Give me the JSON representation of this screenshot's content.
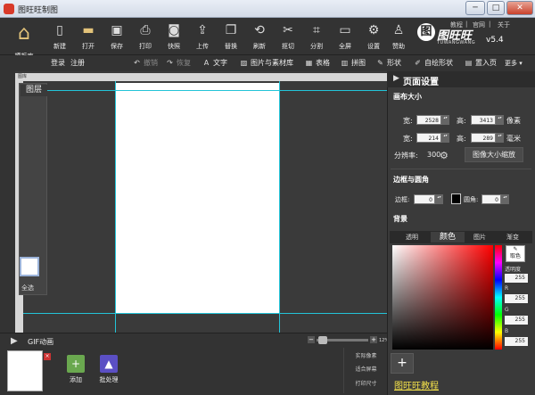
{
  "window": {
    "title": "图旺旺制图",
    "minimize": "─",
    "maximize": "□",
    "close": "✕"
  },
  "toolbar": {
    "home": "模板库",
    "new": "新建",
    "open": "打开",
    "save": "保存",
    "print": "打印",
    "snapshot": "快照",
    "upload": "上传",
    "replace": "替换",
    "refresh": "刷新",
    "cutout": "抠切",
    "split": "分割",
    "fullscreen": "全屏",
    "settings": "设置",
    "sponsor": "赞助"
  },
  "brand": {
    "tutorial": "教程",
    "website": "官网",
    "about": "关于",
    "badge": "图",
    "logo": "图旺旺",
    "sub": "TUWANGWANG",
    "version": "v5.4"
  },
  "toolbar2": {
    "login": "登录",
    "register": "注册",
    "undo": "撤销",
    "redo": "恢复",
    "text": "文字",
    "images": "图片与素材库",
    "table": "表格",
    "collage": "拼图",
    "shape": "形状",
    "custom_shape": "自绘形状",
    "bring_front": "置入页",
    "more": "更多"
  },
  "canvas": {
    "ruler_label": "图库"
  },
  "layers": {
    "title": "图层",
    "select_all": "全选"
  },
  "gif": {
    "label": "GIF动画",
    "zoom_pct": "12%"
  },
  "bottom": {
    "add": "添加",
    "batch": "批处理",
    "actual_pixels": "实际像素",
    "fit_screen": "适合屏幕",
    "print_size": "打印尺寸"
  },
  "panel": {
    "title": "页面设置",
    "canvas_size": "画布大小",
    "width_label": "宽:",
    "height_label": "高:",
    "width_px": "2528",
    "height_px": "3413",
    "unit_px": "像素",
    "width_mm": "214",
    "height_mm": "289",
    "unit_mm": "毫米",
    "resolution_label": "分辨率:",
    "resolution": "300",
    "resize_button": "图像大小缩放",
    "border_section": "边框与圆角",
    "border_label": "边框:",
    "border_value": "0",
    "radius_label": "圆角:",
    "radius_value": "0",
    "background_section": "背景",
    "tabs": [
      "透明",
      "颜色",
      "图片",
      "渐变"
    ],
    "eyedropper": "取色",
    "opacity_label": "透明度",
    "opacity_value": "255",
    "r_label": "R",
    "r_value": "255",
    "g_label": "G",
    "g_value": "255",
    "b_label": "B",
    "b_value": "255",
    "add_swatch": "+",
    "tutorial_link": "图旺旺教程"
  }
}
